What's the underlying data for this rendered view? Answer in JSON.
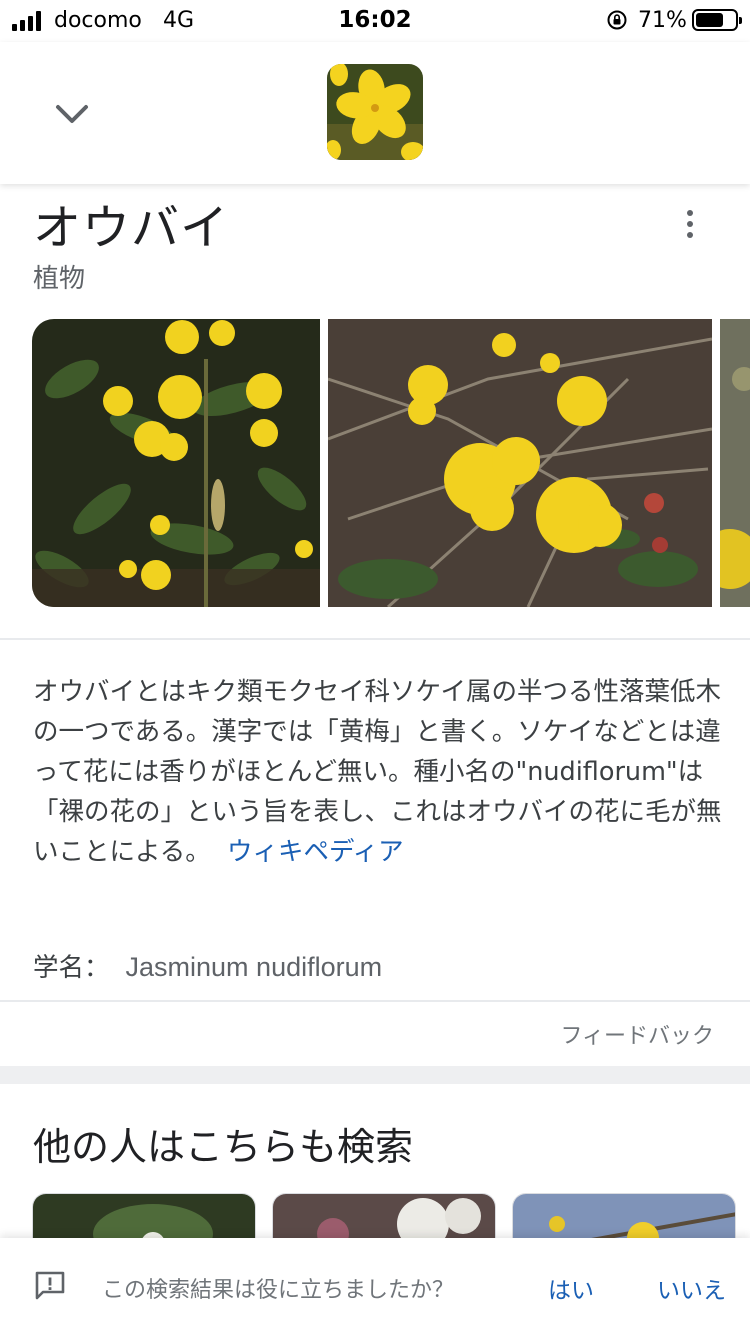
{
  "status_bar": {
    "carrier": "docomo",
    "network": "4G",
    "time": "16:02",
    "battery_percent": "71%",
    "battery_level": 0.71
  },
  "header": {
    "back_icon": "chevron-down-icon",
    "thumbnail": "yellow-flower-thumbnail"
  },
  "panel": {
    "title": "オウバイ",
    "subtitle": "植物",
    "more_icon": "more-vert-icon",
    "images": [
      "yellow-flower-photo-1",
      "yellow-flower-photo-2",
      "yellow-flower-photo-3"
    ],
    "description": "オウバイとはキク類モクセイ科ソケイ属の半つる性落葉低木の一つである。漢字では「黄梅」と書く。ソケイなどとは違って花には香りがほとんど無い。種小名の\"nudiflorum\"は「裸の花の」という旨を表し、これはオウバイの花に毛が無いことによる。",
    "source_link": "ウィキペディア",
    "sci_label": "学名：",
    "sci_value": "Jasminum nudiflorum",
    "feedback": "フィードバック"
  },
  "also_search": {
    "title": "他の人はこちらも検索"
  },
  "bottom_bar": {
    "icon": "feedback-icon",
    "question": "この検索結果は役に立ちましたか？",
    "yes": "はい",
    "no": "いいえ"
  },
  "colors": {
    "link": "#1a5fb4",
    "flower_yellow": "#f2d21e",
    "foliage_dark": "#2b3320"
  }
}
